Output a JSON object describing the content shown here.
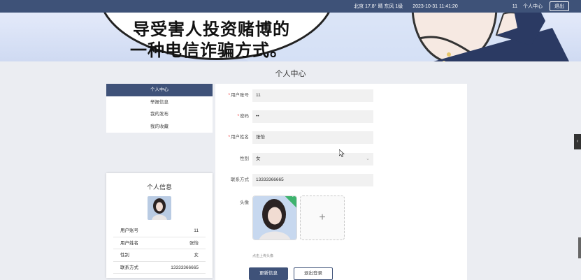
{
  "topbar": {
    "weather": "北京  17.8° 晴 东风 1级",
    "time": "2023-10-31 11:41:20",
    "username": "11",
    "center_link": "个人中心",
    "logout": "退出"
  },
  "banner": {
    "line1": "导受害人投资赌博的",
    "line2": "一种电信诈骗方式。"
  },
  "page_title": "个人中心",
  "menu": {
    "items": [
      "个人中心",
      "举报信息",
      "我的发布",
      "我的收藏"
    ],
    "active_index": 0
  },
  "info_card": {
    "title": "个人信息",
    "rows": [
      {
        "label": "用户账号",
        "value": "11"
      },
      {
        "label": "用户姓名",
        "value": "张怡"
      },
      {
        "label": "性别",
        "value": "女"
      },
      {
        "label": "联系方式",
        "value": "13333366665"
      }
    ]
  },
  "form": {
    "account_label": "用户账号",
    "account_value": "11",
    "password_label": "密码",
    "password_value": "••",
    "name_label": "用户姓名",
    "name_value": "张怡",
    "gender_label": "性别",
    "gender_value": "女",
    "phone_label": "联系方式",
    "phone_value": "13333366665",
    "avatar_label": "头像",
    "upload_tip": "点击上传头像",
    "update_button": "更新信息",
    "logout_button": "退出登录"
  },
  "colors": {
    "primary": "#3f5279",
    "topbar": "#3e5278",
    "page_bg": "#ebedf2"
  }
}
